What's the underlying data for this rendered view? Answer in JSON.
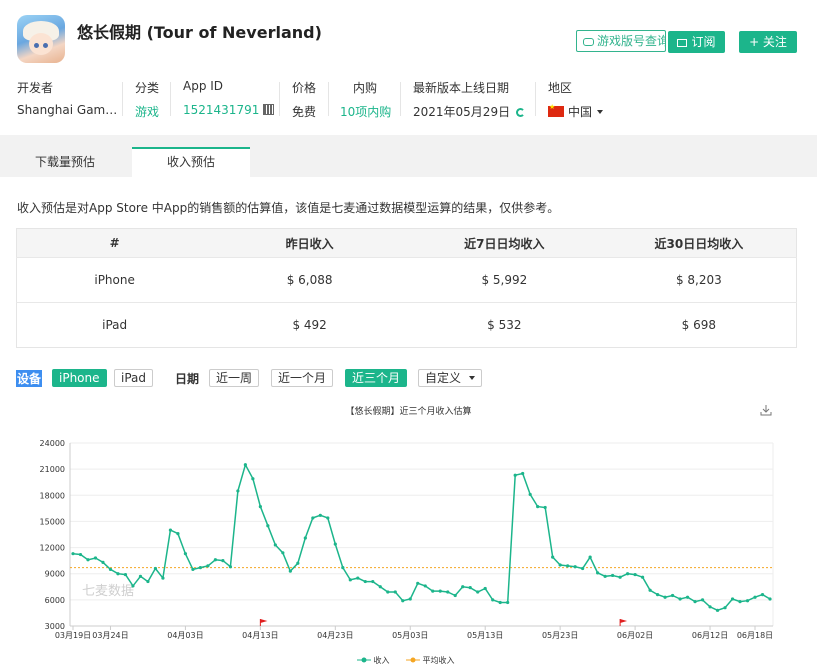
{
  "app": {
    "title": "悠长假期 (Tour of Neverland)",
    "query_label": "游戏版号查询",
    "subscribe_label": "订阅",
    "follow_label": "+ 关注"
  },
  "meta": {
    "developer_label": "开发者",
    "developer_value": "Shanghai Gam…",
    "category_label": "分类",
    "category_value": "游戏",
    "appid_label": "App ID",
    "appid_value": "1521431791",
    "price_label": "价格",
    "price_value": "免费",
    "iap_label": "内购",
    "iap_value": "10项内购",
    "release_label": "最新版本上线日期",
    "release_value": "2021年05月29日",
    "region_label": "地区",
    "region_value": "中国"
  },
  "tabs": [
    {
      "label": "下载量预估"
    },
    {
      "label": "收入预估"
    }
  ],
  "description": "收入预估是对App Store 中App的销售额的估算值，该值是七麦通过数据模型运算的结果，仅供参考。",
  "table": {
    "headers": [
      "#",
      "昨日收入",
      "近7日日均收入",
      "近30日日均收入"
    ],
    "rows": [
      [
        "iPhone",
        "$ 6,088",
        "$ 5,992",
        "$ 8,203"
      ],
      [
        "iPad",
        "$ 492",
        "$ 532",
        "$ 698"
      ]
    ]
  },
  "filters": {
    "device_label": "设备",
    "device_options": [
      "iPhone",
      "iPad"
    ],
    "date_label": "日期",
    "date_options": [
      "近一周",
      "近一个月",
      "近三个月"
    ],
    "custom_label": "自定义"
  },
  "chart_data": {
    "type": "line",
    "title": "【悠长假期】近三个月收入估算",
    "watermark": "七麦数据",
    "ylim": [
      3000,
      24000
    ],
    "y_ticks": [
      3000,
      6000,
      9000,
      12000,
      15000,
      18000,
      21000,
      24000
    ],
    "x_tick_labels": [
      "03月19日",
      "03月24日",
      "04月03日",
      "04月13日",
      "04月23日",
      "05月03日",
      "05月13日",
      "05月23日",
      "06月02日",
      "06月12日",
      "06月18日"
    ],
    "x_tick_days": [
      0,
      5,
      15,
      25,
      35,
      45,
      55,
      65,
      75,
      85,
      91
    ],
    "x_start_label": "03月19日",
    "series": [
      {
        "name": "收入",
        "color": "#1cb58b",
        "values": [
          11300,
          11200,
          10600,
          10800,
          10300,
          9500,
          9000,
          8900,
          7600,
          8700,
          8100,
          9600,
          8500,
          14000,
          13600,
          11300,
          9500,
          9700,
          9900,
          10600,
          10500,
          9800,
          18500,
          21500,
          19900,
          16700,
          14500,
          12300,
          11400,
          9300,
          10200,
          13100,
          15400,
          15700,
          15400,
          12400,
          9700,
          8300,
          8500,
          8100,
          8100,
          7500,
          6900,
          6900,
          5900,
          6100,
          7900,
          7600,
          7000,
          7000,
          6900,
          6500,
          7500,
          7400,
          6900,
          7300,
          6000,
          5700,
          5700,
          20300,
          20500,
          18100,
          16700,
          16600,
          10900,
          10000,
          9900,
          9800,
          9600,
          10900,
          9100,
          8700,
          8800,
          8600,
          9000,
          8900,
          8600,
          7100,
          6600,
          6300,
          6500,
          6100,
          6300,
          5800,
          6000,
          5200,
          4800,
          5100,
          6100,
          5800,
          5900,
          6300,
          6600,
          6100
        ]
      },
      {
        "name": "平均收入",
        "color": "#f5a623",
        "values_constant": 9700
      }
    ],
    "flags": [
      25,
      73
    ],
    "legend": [
      "收入",
      "平均收入"
    ]
  }
}
